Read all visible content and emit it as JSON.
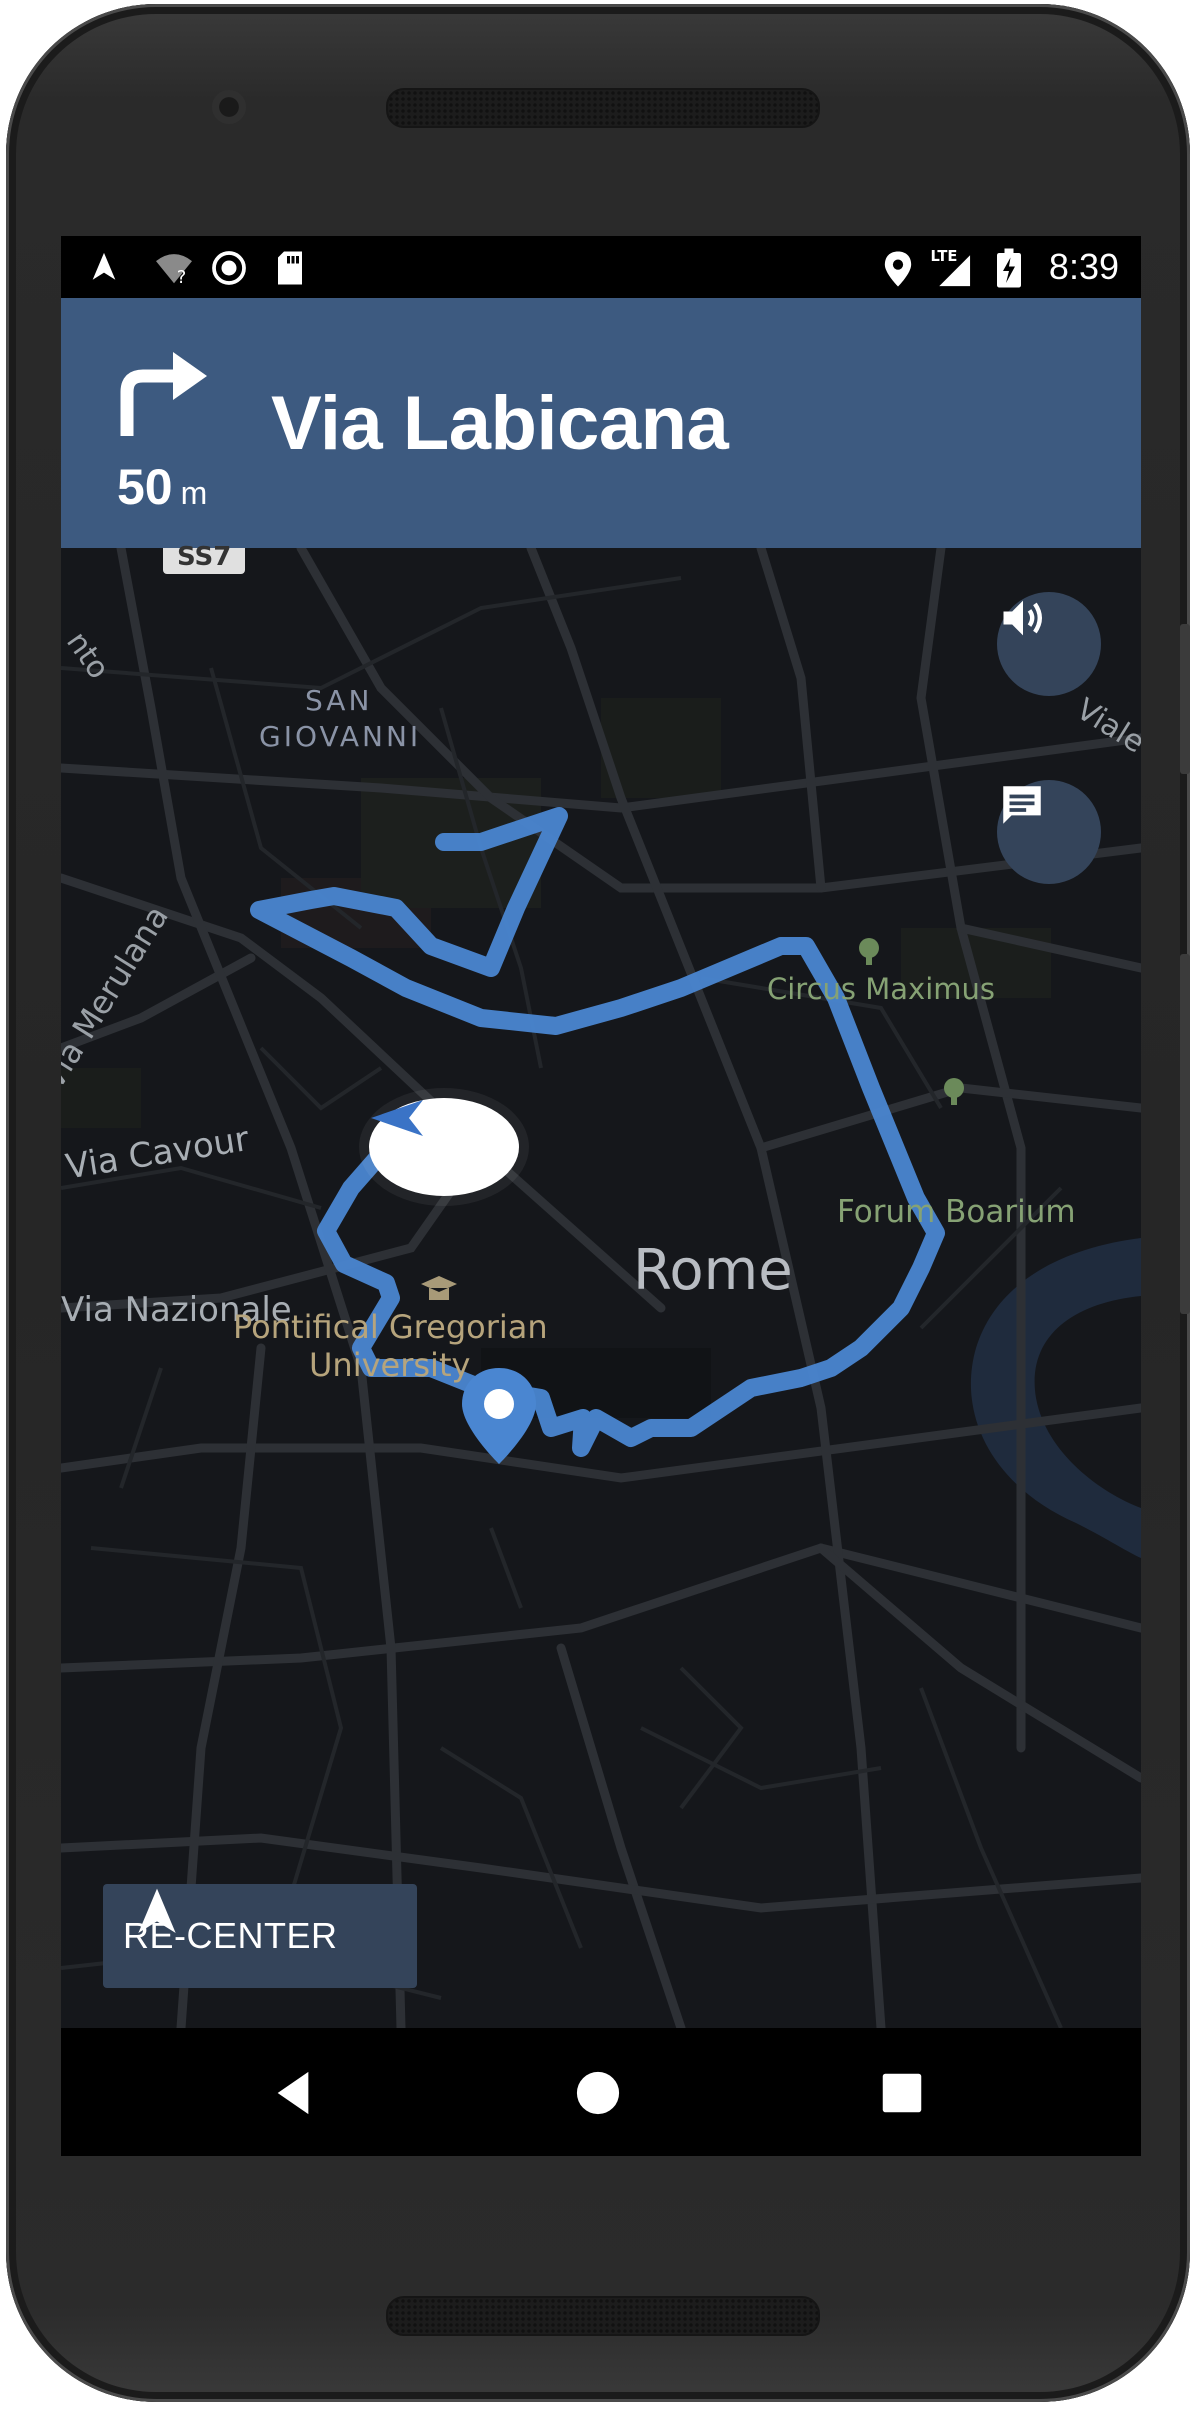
{
  "status_bar": {
    "time": "8:39",
    "network": "LTE",
    "left_icons": [
      "navigation-icon",
      "wifi-unknown-icon",
      "record-icon",
      "sd-card-icon"
    ],
    "right_icons": [
      "location-icon",
      "lte-signal-icon",
      "battery-charging-icon"
    ]
  },
  "navigation": {
    "street": "Via Labicana",
    "distance_value": "50",
    "distance_unit": "m",
    "maneuver": "turn-right"
  },
  "map": {
    "labels": {
      "ss7": "SS7",
      "san": "SAN",
      "giovanni": "GIOVANNI",
      "via_merulana": "Via Merulana",
      "via_cavour": "Via Cavour",
      "via_nazionale": "Via Nazionale",
      "circus_maximus": "Circus Maximus",
      "forum_boarium": "Forum Boarium",
      "rome": "Rome",
      "pontifical_1": "Pontifical Gregorian",
      "pontifical_2": "University",
      "viale": "Viale M",
      "nto": "nto"
    },
    "route_color": "#4a86d1",
    "land_color": "#15171b",
    "water_color": "#1f2b3d"
  },
  "controls": {
    "recenter_label": "RE-CENTER",
    "sound_button": "volume-icon",
    "messages_button": "message-icon"
  },
  "colors": {
    "header_bg": "#3d5a80",
    "control_bg": "#34445a"
  }
}
